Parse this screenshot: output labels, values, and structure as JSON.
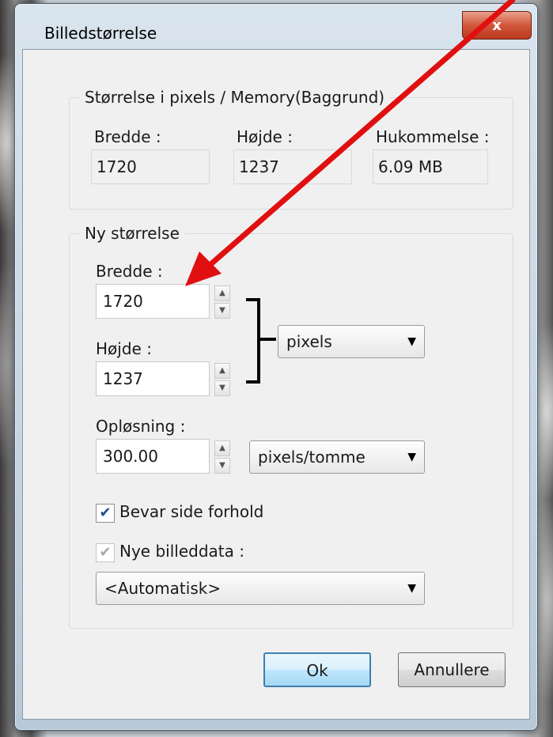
{
  "dialog": {
    "title": "Billedstørrelse",
    "close_label": "x"
  },
  "current": {
    "legend": "Størrelse i pixels / Memory(Baggrund)",
    "width_label": "Bredde :",
    "width_value": "1720",
    "height_label": "Højde :",
    "height_value": "1237",
    "memory_label": "Hukommelse :",
    "memory_value": "6.09 MB"
  },
  "new_size": {
    "legend": "Ny størrelse",
    "width_label": "Bredde :",
    "width_value": "1720",
    "height_label": "Højde :",
    "height_value": "1237",
    "unit_value": "pixels",
    "resolution_label": "Opløsning :",
    "resolution_value": "300.00",
    "resolution_unit": "pixels/tomme",
    "keep_ratio_label": "Bevar side forhold",
    "keep_ratio_checked": true,
    "new_data_label": "Nye billeddata :",
    "new_data_checked": true,
    "resample_value": "<Automatisk>"
  },
  "buttons": {
    "ok": "Ok",
    "cancel": "Annullere"
  },
  "colors": {
    "arrow": "#e01010",
    "accent": "#3c7fb1"
  },
  "icons": [
    "close-icon",
    "spin-up-icon",
    "spin-down-icon",
    "dropdown-arrow-icon",
    "checkmark-icon",
    "annotation-arrow"
  ]
}
